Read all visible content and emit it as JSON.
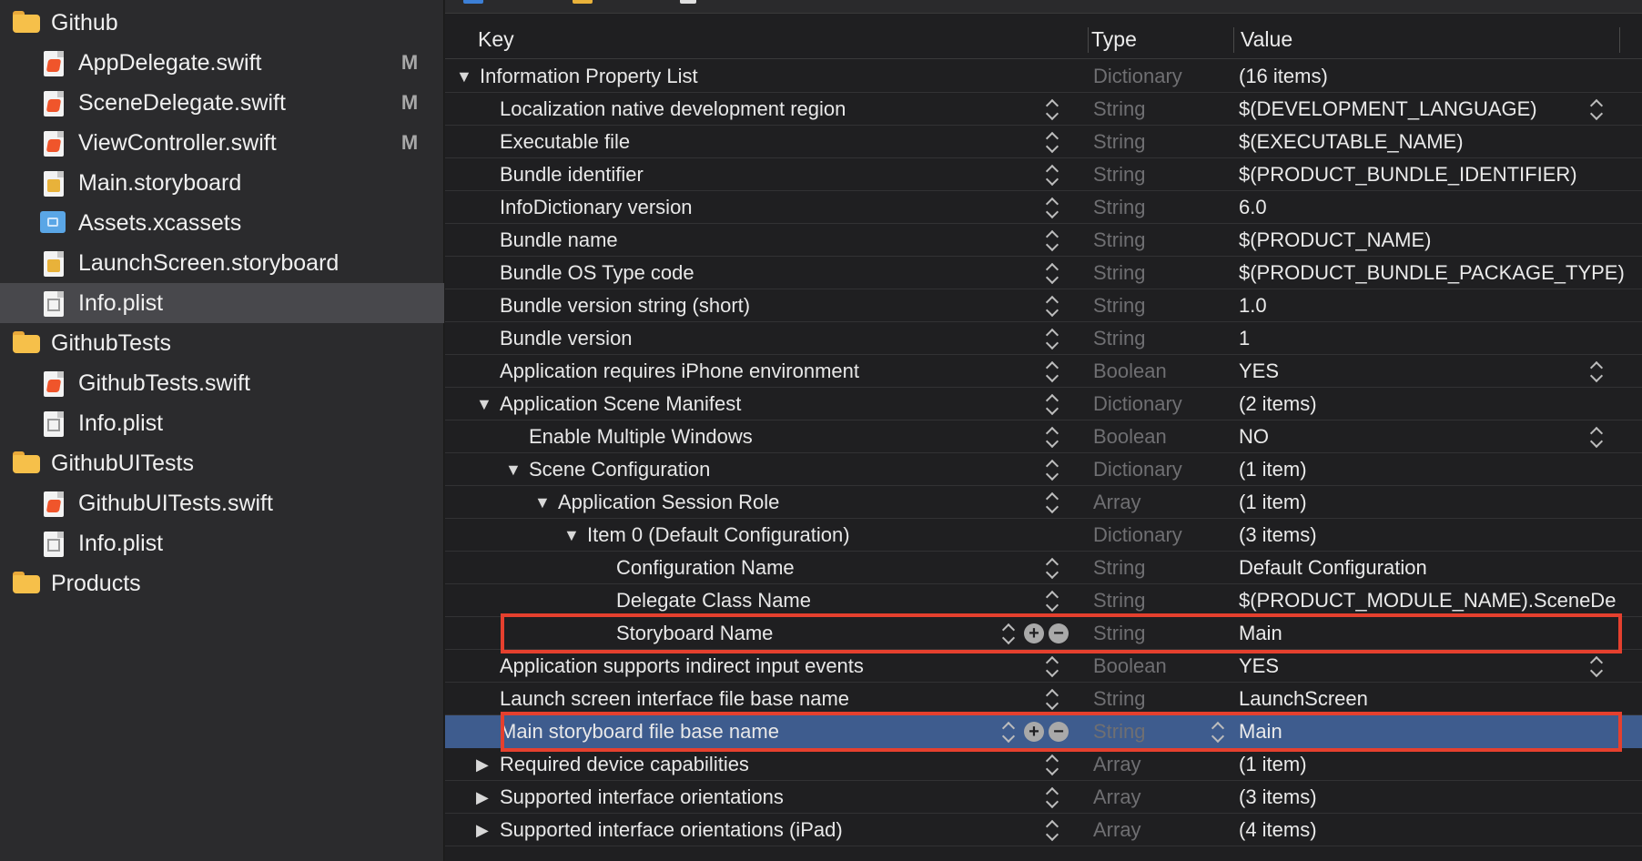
{
  "navigator": {
    "items": [
      {
        "name": "Github",
        "kind": "folder",
        "indent": 0,
        "badge": ""
      },
      {
        "name": "AppDelegate.swift",
        "kind": "swift",
        "indent": 1,
        "badge": "M"
      },
      {
        "name": "SceneDelegate.swift",
        "kind": "swift",
        "indent": 1,
        "badge": "M"
      },
      {
        "name": "ViewController.swift",
        "kind": "swift",
        "indent": 1,
        "badge": "M"
      },
      {
        "name": "Main.storyboard",
        "kind": "storyboard",
        "indent": 1,
        "badge": ""
      },
      {
        "name": "Assets.xcassets",
        "kind": "xcassets",
        "indent": 1,
        "badge": ""
      },
      {
        "name": "LaunchScreen.storyboard",
        "kind": "storyboard",
        "indent": 1,
        "badge": ""
      },
      {
        "name": "Info.plist",
        "kind": "plist",
        "indent": 1,
        "badge": "",
        "selected": true
      },
      {
        "name": "GithubTests",
        "kind": "folder",
        "indent": 0,
        "badge": ""
      },
      {
        "name": "GithubTests.swift",
        "kind": "swift",
        "indent": 1,
        "badge": ""
      },
      {
        "name": "Info.plist",
        "kind": "plist",
        "indent": 1,
        "badge": ""
      },
      {
        "name": "GithubUITests",
        "kind": "folder",
        "indent": 0,
        "badge": ""
      },
      {
        "name": "GithubUITests.swift",
        "kind": "swift",
        "indent": 1,
        "badge": ""
      },
      {
        "name": "Info.plist",
        "kind": "plist",
        "indent": 1,
        "badge": ""
      },
      {
        "name": "Products",
        "kind": "folder",
        "indent": 0,
        "badge": ""
      }
    ]
  },
  "plist": {
    "columns": {
      "key": "Key",
      "type": "Type",
      "value": "Value"
    },
    "rows": [
      {
        "key": "Information Property List",
        "type": "Dictionary",
        "value": "(16 items)",
        "level": 0,
        "disclosure": "open",
        "stepper": false,
        "value_stepper": false
      },
      {
        "key": "Localization native development region",
        "type": "String",
        "value": "$(DEVELOPMENT_LANGUAGE)",
        "level": 1,
        "disclosure": "",
        "stepper": true,
        "value_stepper": true
      },
      {
        "key": "Executable file",
        "type": "String",
        "value": "$(EXECUTABLE_NAME)",
        "level": 1,
        "disclosure": "",
        "stepper": true,
        "value_stepper": false
      },
      {
        "key": "Bundle identifier",
        "type": "String",
        "value": "$(PRODUCT_BUNDLE_IDENTIFIER)",
        "level": 1,
        "disclosure": "",
        "stepper": true,
        "value_stepper": false
      },
      {
        "key": "InfoDictionary version",
        "type": "String",
        "value": "6.0",
        "level": 1,
        "disclosure": "",
        "stepper": true,
        "value_stepper": false
      },
      {
        "key": "Bundle name",
        "type": "String",
        "value": "$(PRODUCT_NAME)",
        "level": 1,
        "disclosure": "",
        "stepper": true,
        "value_stepper": false
      },
      {
        "key": "Bundle OS Type code",
        "type": "String",
        "value": "$(PRODUCT_BUNDLE_PACKAGE_TYPE)",
        "level": 1,
        "disclosure": "",
        "stepper": true,
        "value_stepper": false
      },
      {
        "key": "Bundle version string (short)",
        "type": "String",
        "value": "1.0",
        "level": 1,
        "disclosure": "",
        "stepper": true,
        "value_stepper": false
      },
      {
        "key": "Bundle version",
        "type": "String",
        "value": "1",
        "level": 1,
        "disclosure": "",
        "stepper": true,
        "value_stepper": false
      },
      {
        "key": "Application requires iPhone environment",
        "type": "Boolean",
        "value": "YES",
        "level": 1,
        "disclosure": "",
        "stepper": true,
        "value_stepper": true
      },
      {
        "key": "Application Scene Manifest",
        "type": "Dictionary",
        "value": "(2 items)",
        "level": 1,
        "disclosure": "open",
        "stepper": true,
        "value_stepper": false
      },
      {
        "key": "Enable Multiple Windows",
        "type": "Boolean",
        "value": "NO",
        "level": 2,
        "disclosure": "",
        "stepper": true,
        "value_stepper": true
      },
      {
        "key": "Scene Configuration",
        "type": "Dictionary",
        "value": "(1 item)",
        "level": 2,
        "disclosure": "open",
        "stepper": true,
        "value_stepper": false
      },
      {
        "key": "Application Session Role",
        "type": "Array",
        "value": "(1 item)",
        "level": 3,
        "disclosure": "open",
        "stepper": true,
        "value_stepper": false
      },
      {
        "key": "Item 0 (Default Configuration)",
        "type": "Dictionary",
        "value": "(3 items)",
        "level": 4,
        "disclosure": "open",
        "stepper": false,
        "value_stepper": false
      },
      {
        "key": "Configuration Name",
        "type": "String",
        "value": "Default Configuration",
        "level": 5,
        "disclosure": "",
        "stepper": true,
        "value_stepper": false
      },
      {
        "key": "Delegate Class Name",
        "type": "String",
        "value": "$(PRODUCT_MODULE_NAME).SceneDe",
        "level": 5,
        "disclosure": "",
        "stepper": true,
        "value_stepper": false
      },
      {
        "key": "Storyboard Name",
        "type": "String",
        "value": "Main",
        "level": 5,
        "disclosure": "",
        "stepper": true,
        "value_stepper": false,
        "edit_buttons": true,
        "highlight": true
      },
      {
        "key": "Application supports indirect input events",
        "type": "Boolean",
        "value": "YES",
        "level": 1,
        "disclosure": "",
        "stepper": true,
        "value_stepper": true
      },
      {
        "key": "Launch screen interface file base name",
        "type": "String",
        "value": "LaunchScreen",
        "level": 1,
        "disclosure": "",
        "stepper": true,
        "value_stepper": false
      },
      {
        "key": "Main storyboard file base name",
        "type": "String",
        "value": "Main",
        "level": 1,
        "disclosure": "",
        "stepper": true,
        "value_stepper": false,
        "edit_buttons": true,
        "highlight": true,
        "selected": true,
        "type_stepper": true
      },
      {
        "key": "Required device capabilities",
        "type": "Array",
        "value": "(1 item)",
        "level": 1,
        "disclosure": "closed",
        "stepper": true,
        "value_stepper": false
      },
      {
        "key": "Supported interface orientations",
        "type": "Array",
        "value": "(3 items)",
        "level": 1,
        "disclosure": "closed",
        "stepper": true,
        "value_stepper": false
      },
      {
        "key": "Supported interface orientations (iPad)",
        "type": "Array",
        "value": "(4 items)",
        "level": 1,
        "disclosure": "closed",
        "stepper": true,
        "value_stepper": false
      }
    ]
  },
  "icons": {
    "add": "+",
    "remove": "−",
    "disclosure_open": "▼",
    "disclosure_closed": "▶"
  },
  "colors": {
    "highlight_border": "#e5402e",
    "selection": "#3e5c8e"
  }
}
